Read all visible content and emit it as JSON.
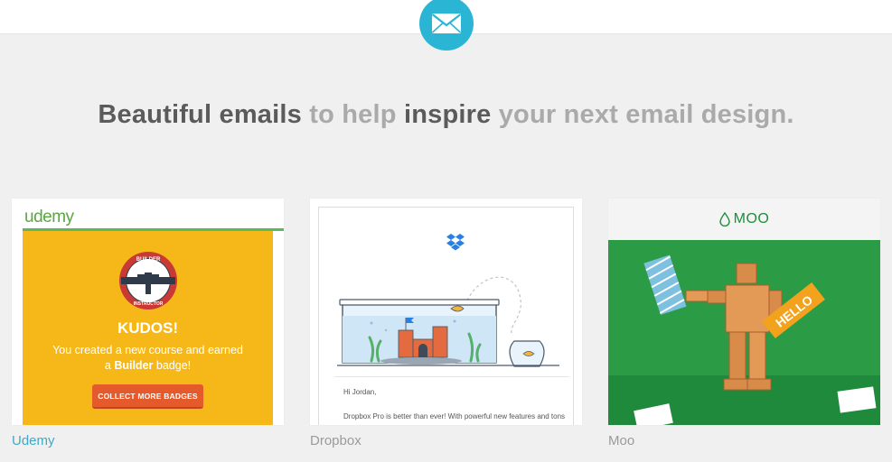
{
  "header": {
    "icon": "envelope-icon",
    "accent_color": "#2bb5d4"
  },
  "headline": {
    "part1": "Beautiful emails",
    "part2": " to help ",
    "part3": "inspire",
    "part4": " your next email design."
  },
  "cards": [
    {
      "caption": "Udemy",
      "logo": "udemy",
      "badge_top": "BUILDER",
      "badge_bottom": "INSTRUCTOR",
      "title": "KUDOS!",
      "message_line1": "You created a new course and earned",
      "message_line2_pre": "a ",
      "message_line2_bold": "Builder",
      "message_line2_post": " badge!",
      "button": "COLLECT MORE BADGES",
      "brand_color": "#f6b818"
    },
    {
      "caption": "Dropbox",
      "logo_icon": "dropbox-icon",
      "greeting": "Hi Jordan,",
      "body": "Dropbox Pro is better than ever! With powerful new features and tons of space, now's a great time to make Dropbox Pro the home"
    },
    {
      "caption": "Moo",
      "logo": "MOO",
      "logo_icon": "drop-icon",
      "sign_text": "HELLO",
      "brand_color": "#249340"
    }
  ]
}
